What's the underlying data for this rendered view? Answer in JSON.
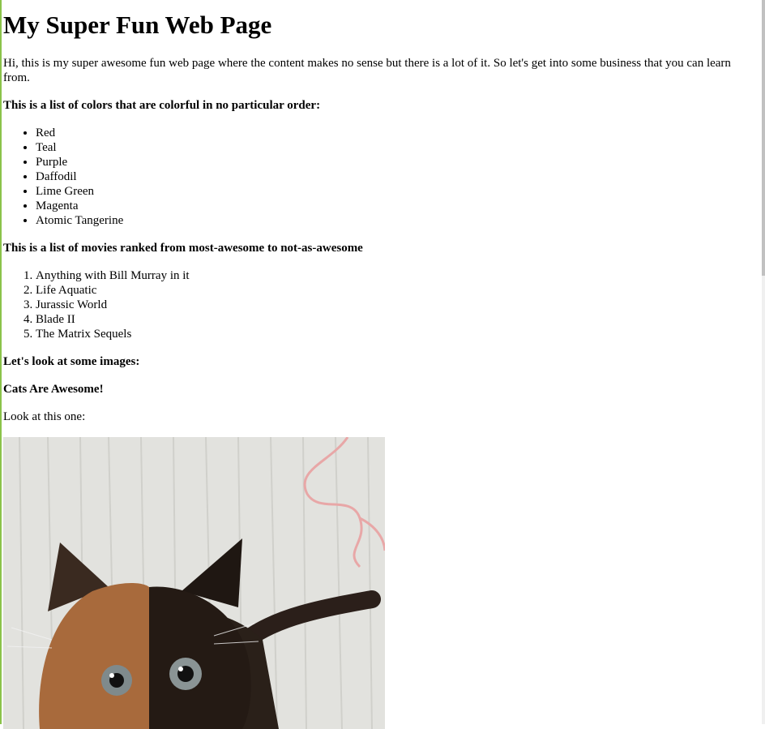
{
  "page": {
    "title": "My Super Fun Web Page",
    "intro": "Hi, this is my super awesome fun web page where the content makes no sense but there is a lot of it. So let's get into some business that you can learn from."
  },
  "colors_section": {
    "heading": "This is a list of colors that are colorful in no particular order:",
    "items": [
      "Red",
      "Teal",
      "Purple",
      "Daffodil",
      "Lime Green",
      "Magenta",
      "Atomic Tangerine"
    ]
  },
  "movies_section": {
    "heading": "This is a list of movies ranked from most-awesome to not-as-awesome",
    "items": [
      "Anything with Bill Murray in it",
      "Life Aquatic",
      "Jurassic World",
      "Blade II",
      "The Matrix Sequels"
    ]
  },
  "images_section": {
    "heading": "Let's look at some images:",
    "subheading": "Cats Are Awesome!",
    "caption": "Look at this one:"
  }
}
